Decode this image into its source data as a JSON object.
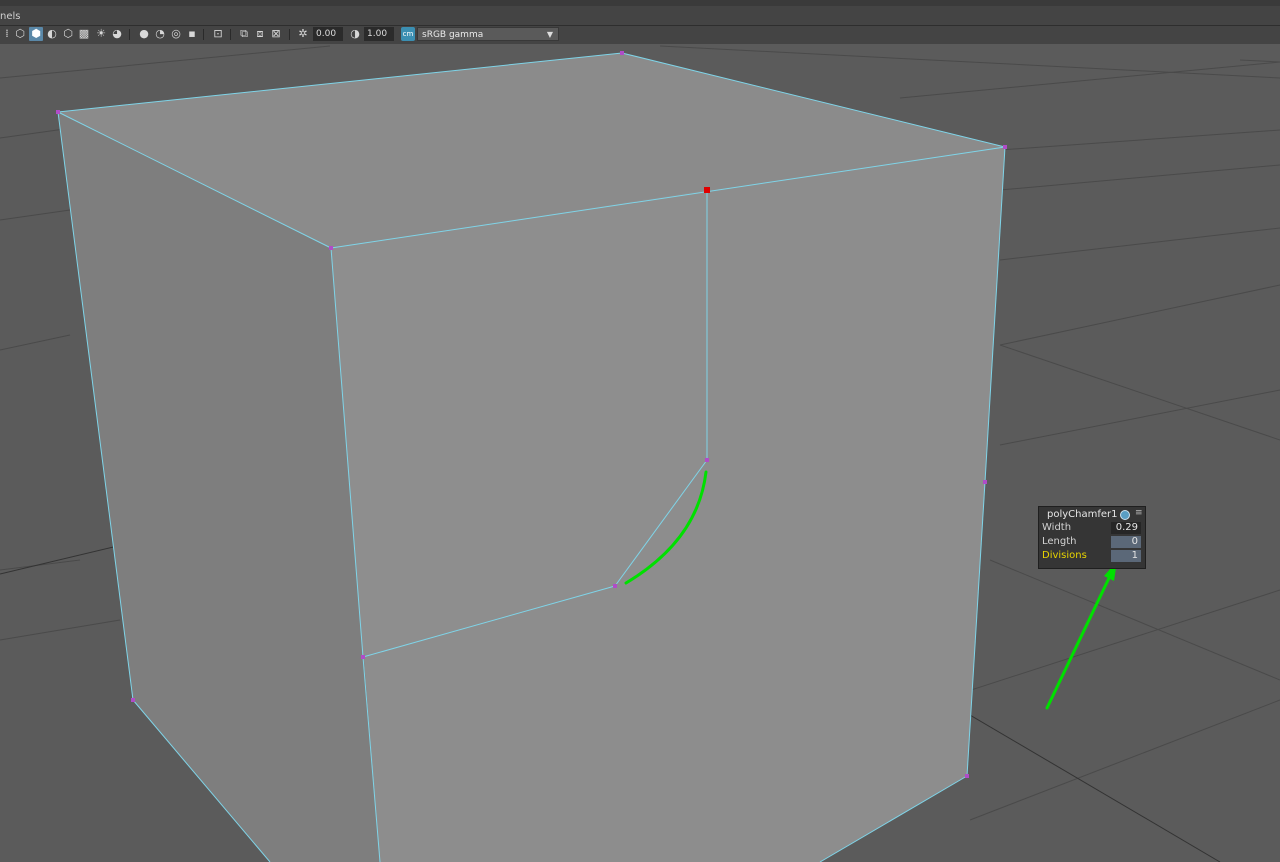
{
  "menubar": {
    "partial_label": "nels"
  },
  "toolbar": {
    "exposure_value": "0.00",
    "gamma_value": "1.00",
    "colorspace": "sRGB gamma"
  },
  "hud": {
    "title": "polyChamfer1",
    "rows": [
      {
        "label": "Width",
        "value": "0.29"
      },
      {
        "label": "Length",
        "value": "0"
      },
      {
        "label": "Divisions",
        "value": "1"
      }
    ]
  },
  "colors": {
    "wireframe": "#7fd4e8",
    "annotation": "#00e000",
    "highlight_label": "#e8d400",
    "selected_vertex": "#e00000"
  }
}
